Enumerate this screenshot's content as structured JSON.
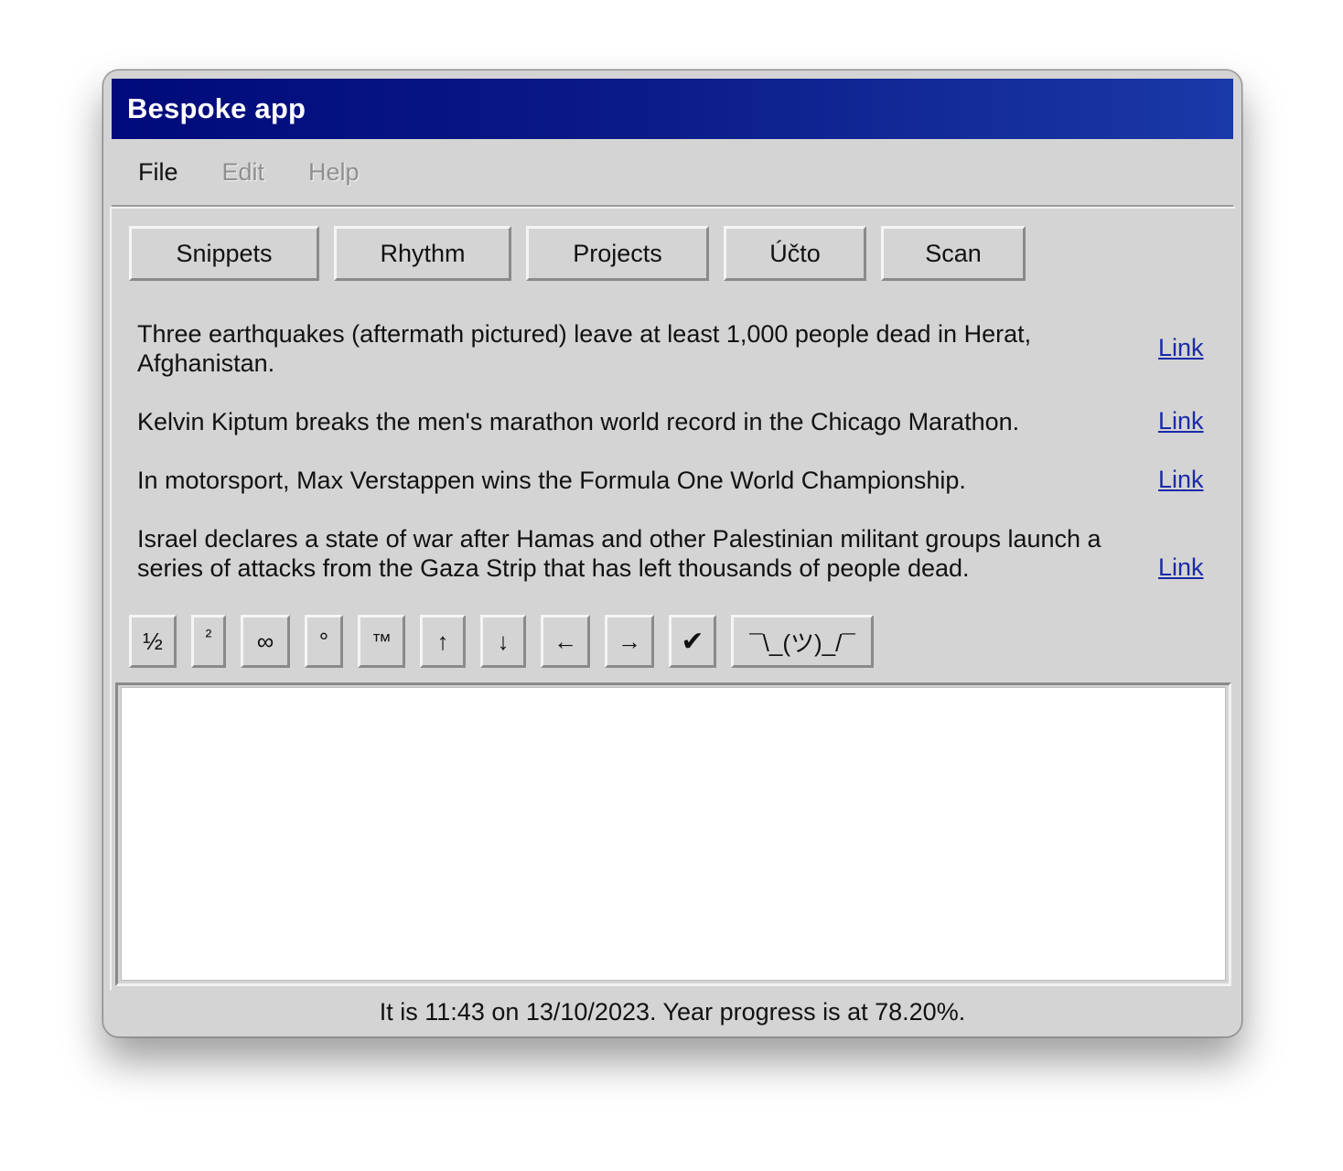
{
  "window": {
    "title": "Bespoke app"
  },
  "menu": {
    "items": [
      {
        "label": "File",
        "enabled": true
      },
      {
        "label": "Edit",
        "enabled": false
      },
      {
        "label": "Help",
        "enabled": false
      }
    ]
  },
  "toolbar": {
    "buttons": [
      "Snippets",
      "Rhythm",
      "Projects",
      "Účto",
      "Scan"
    ]
  },
  "news": {
    "items": [
      {
        "text": "Three earthquakes (aftermath pictured) leave at least 1,000 people dead in Herat, Afghanistan.",
        "link": "Link"
      },
      {
        "text": "Kelvin Kiptum breaks the men's marathon world record in the Chicago Marathon.",
        "link": "Link"
      },
      {
        "text": "In motorsport, Max Verstappen wins the Formula One World Championship.",
        "link": "Link"
      },
      {
        "text": "Israel declares a state of war after Hamas and other Palestinian militant groups launch a series of attacks from the Gaza Strip that has left thousands of people dead.",
        "link": "Link"
      }
    ]
  },
  "symbols": {
    "buttons": [
      "½",
      "²",
      "∞",
      "°",
      "™",
      "↑",
      "↓",
      "←",
      "→",
      "✔",
      "¯\\_(ツ)_/¯"
    ]
  },
  "editor": {
    "value": ""
  },
  "status": {
    "text": "It is 11:43 on 13/10/2023. Year progress is at 78.20%."
  }
}
